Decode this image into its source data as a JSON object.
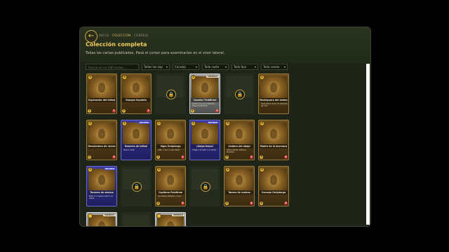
{
  "header": {
    "back_icon": "arrow-left-icon",
    "breadcrumb": {
      "home": "INICIO",
      "sep1": " · ",
      "current": "COLECCIÓN",
      "sep2": " · ",
      "sub": "CONSEJO"
    },
    "title": "Colección completa",
    "subtitle": "Todas las cartas publicadas. Pasá el cursor para examinarlas en el visor lateral."
  },
  "toolbar": {
    "search_placeholder": "Buscar en las 280 cartas...",
    "filters": [
      "Todas las exp",
      "Consejo",
      "Todo coste",
      "Todo tipo",
      "Toda rareza"
    ]
  },
  "cards": [
    {
      "name": "Explorador del trébol",
      "cost": "3",
      "atk": "1",
      "hp": "1",
      "style": "",
      "badge": "",
      "desc": ""
    },
    {
      "name": "Ganapo inquieto",
      "cost": "3",
      "atk": "2",
      "hp": "2",
      "style": "",
      "badge": "",
      "desc": ""
    },
    {
      "locked": true
    },
    {
      "name": "Cazador Palafirme",
      "cost": "3",
      "atk": "2",
      "hp": "2",
      "style": "silver",
      "badge": "PREMIUM",
      "desc": "Aliado a los que sustentan: Hojas de Baluarte."
    },
    {
      "locked": true
    },
    {
      "name": "Madriguera del ámbar",
      "cost": "2",
      "atk": "",
      "hp": "",
      "style": "",
      "badge": "",
      "desc": "Cada aliado entra con Voluntad de 1 PV."
    },
    {
      "name": "Recolectora de raíces",
      "cost": "2",
      "atk": "2",
      "hp": "3",
      "style": "",
      "badge": "",
      "desc": ""
    },
    {
      "name": "Reserva de trébol",
      "cost": "1",
      "atk": "",
      "hp": "",
      "style": "blue",
      "badge": "HECHIZO",
      "desc": "Roba 1 carta."
    },
    {
      "name": "Vigía Orejalarga",
      "cost": "1",
      "atk": "1",
      "hp": "1",
      "style": "",
      "badge": "",
      "desc": "Grito: +1/+1 a otro aliado."
    },
    {
      "name": "¡Golpe tosco!",
      "cost": "1",
      "atk": "",
      "hp": "",
      "style": "blue",
      "badge": "HECHIZO",
      "desc": "Inflige 1 de daño a un aliado."
    },
    {
      "name": "Lindero del abajo",
      "cost": "3",
      "atk": "3",
      "hp": "2",
      "style": "",
      "badge": "",
      "desc": "Último aliento: Roba un Plumillón."
    },
    {
      "name": "Madre de la barranca",
      "cost": "3",
      "atk": "3",
      "hp": "4",
      "style": "",
      "badge": "",
      "desc": ""
    },
    {
      "name": "Tocones de alarma",
      "cost": "1",
      "atk": "",
      "hp": "",
      "style": "blue",
      "badge": "HECHIZO",
      "desc": "Roba 1 si vuelve a aliar a un aliado."
    },
    {
      "locked": true
    },
    {
      "name": "Capitana Palafirme",
      "cost": "3",
      "atk": "2",
      "hp": "5",
      "style": "",
      "badge": "",
      "desc": "Los aliados obtienen +1/+1."
    },
    {
      "locked": true
    },
    {
      "name": "Tanera de rostros",
      "cost": "4",
      "atk": "3",
      "hp": "4",
      "style": "",
      "badge": "",
      "desc": ""
    },
    {
      "name": "Consejo Orejalarga",
      "cost": "5",
      "atk": "4",
      "hp": "5",
      "style": "",
      "badge": "",
      "desc": ""
    },
    {
      "name": "",
      "cost": "",
      "atk": "",
      "hp": "",
      "style": "silver",
      "badge": "PREMIUM",
      "desc": "",
      "partial": true
    },
    {
      "locked": true,
      "partial": true
    },
    {
      "name": "",
      "cost": "",
      "atk": "",
      "hp": "",
      "style": "silver",
      "badge": "PREMIUM",
      "desc": "",
      "partial": true
    }
  ],
  "colors": {
    "accent": "#f0cc56",
    "panel": "#1e2418",
    "hp": "#c83030"
  },
  "icons": {
    "lock": "lock-icon"
  }
}
